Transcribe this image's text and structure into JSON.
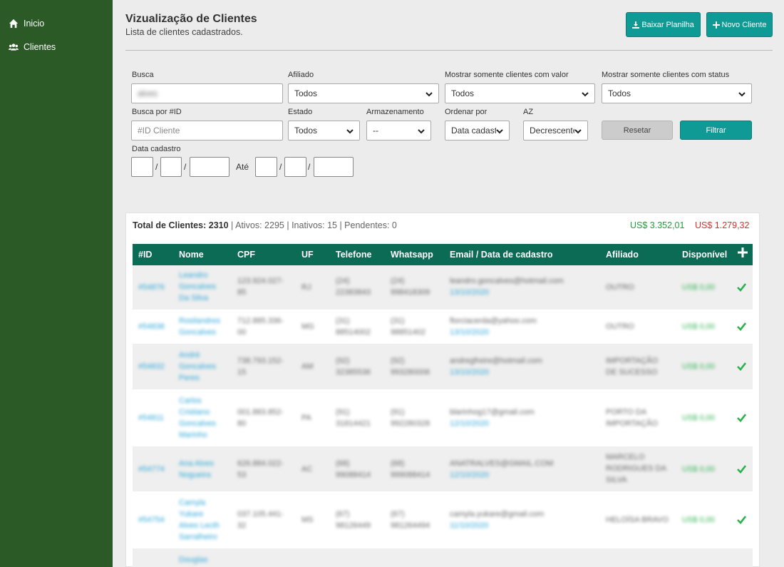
{
  "sidebar": {
    "items": [
      {
        "label": "Inicio",
        "icon": "home-icon"
      },
      {
        "label": "Clientes",
        "icon": "users-icon"
      }
    ]
  },
  "header": {
    "title": "Vizualização de Clientes",
    "subtitle": "Lista de clientes cadastrados.",
    "download_label": "Baixar Planilha",
    "new_label": "Novo Cliente"
  },
  "filters": {
    "busca_label": "Busca",
    "busca_value": "alves",
    "afiliado_label": "Afiliado",
    "afiliado_value": "Todos",
    "valor_label": "Mostrar somente clientes com valor",
    "valor_value": "Todos",
    "status_label": "Mostrar somente clientes com status",
    "status_value": "Todos",
    "id_label": "Busca por #ID",
    "id_placeholder": "#ID Cliente",
    "estado_label": "Estado",
    "estado_value": "Todos",
    "armazenamento_label": "Armazenamento",
    "armazenamento_value": "--",
    "ordenar_label": "Ordenar por",
    "ordenar_value": "Data cadastro",
    "az_label": "AZ",
    "az_value": "Decrescente",
    "reset_label": "Resetar",
    "filter_label": "Filtrar",
    "data_label": "Data cadastro",
    "ate_label": "Até",
    "slash": "/"
  },
  "summary": {
    "total_label": "Total de Clientes:",
    "total_value": "2310",
    "rest": "| Ativos: 2295 | Inativos: 15 | Pendentes: 0",
    "money_green": "US$ 3.352,01",
    "money_red": "US$ 1.279,32"
  },
  "table": {
    "headers": [
      "#ID",
      "Nome",
      "CPF",
      "UF",
      "Telefone",
      "Whatsapp",
      "Email / Data de cadastro",
      "Afiliado",
      "Disponível"
    ],
    "rows": [
      {
        "id": "#54876",
        "name": "Leandro\nGoncalves\nDa Silva",
        "cpf": "123.924.027-\n85",
        "uf": "RJ",
        "tel": "(24)\n22383843",
        "wpp": "(24)\n998418309",
        "email": "leandro.goncalves@hotmail.com",
        "date": "13/10/2020",
        "afil": "OUTRO",
        "disp": "US$ 0,00"
      },
      {
        "id": "#54838",
        "name": "Rosilandres\nGoncalves",
        "cpf": "712.885.336-\n00",
        "uf": "MG",
        "tel": "(31)\n88514002",
        "wpp": "(31)\n98851402",
        "email": "florciacerda@yahoo.com",
        "date": "13/10/2020",
        "afil": "OUTRO",
        "disp": "US$ 0,00"
      },
      {
        "id": "#54832",
        "name": "André\nGoncalves\nPeres",
        "cpf": "738.793.152-\n15",
        "uf": "AM",
        "tel": "(92)\n32385536",
        "wpp": "(92)\n993280006",
        "email": "andregfreire@hotmail.com",
        "date": "13/10/2020",
        "afil": "IMPORTAÇÃO\nDE SUCESSO",
        "disp": "US$ 0,00"
      },
      {
        "id": "#54811",
        "name": "Carlos\nCristiano\nGoncalves\nMarinho",
        "cpf": "001.883.852-\n80",
        "uf": "PA",
        "tel": "(91)\n31814421",
        "wpp": "(91)\n992280328",
        "email": "blarinhog17@gmail.com",
        "date": "12/10/2020",
        "afil": "PORTO DA\nIMPORTAÇÃO",
        "disp": "US$ 0,00"
      },
      {
        "id": "#54774",
        "name": "Ana Alves\nNogueira",
        "cpf": "626.884.022-\n53",
        "uf": "AC",
        "tel": "(68)\n99088414",
        "wpp": "(68)\n999088414",
        "email": "ANATRALVES@GMAIL.COM",
        "date": "12/10/2020",
        "afil": "MARCELO\nRODRIGUES DA\nSILVA",
        "disp": "US$ 0,00"
      },
      {
        "id": "#54754",
        "name": "Camyla\nYukare\nAlves Lecth\nSarralheiro",
        "cpf": "037.105.441-\n32",
        "uf": "MS",
        "tel": "(67)\n98126449",
        "wpp": "(67)\n981264494",
        "email": "camyla.yukare@gmail.com",
        "date": "11/10/2020",
        "afil": "HELOÍSA BRAVO",
        "disp": "US$ 0,00"
      },
      {
        "id": "",
        "name": "Douglas",
        "cpf": "",
        "uf": "",
        "tel": "",
        "wpp": "",
        "email": "",
        "date": "",
        "afil": "",
        "disp": ""
      }
    ]
  }
}
